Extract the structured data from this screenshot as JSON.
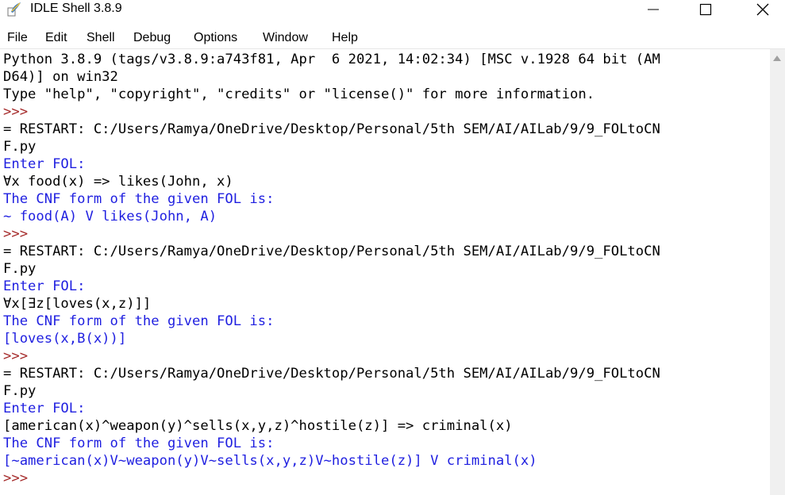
{
  "window": {
    "title": "IDLE Shell 3.8.9",
    "icon": "python-feather-icon"
  },
  "menubar": [
    "File",
    "Edit",
    "Shell",
    "Debug",
    "Options",
    "Window",
    "Help"
  ],
  "colors": {
    "stdout": "#000000",
    "stdin_prompt": "#1f1fe0",
    "shell_prompt": "#a52a2a"
  },
  "shell_lines": [
    {
      "text": "Python 3.8.9 (tags/v3.8.9:a743f81, Apr  6 2021, 14:02:34) [MSC v.1928 64 bit (AM",
      "kind": "out"
    },
    {
      "text": "D64)] on win32",
      "kind": "out"
    },
    {
      "text": "Type \"help\", \"copyright\", \"credits\" or \"license()\" for more information.",
      "kind": "out"
    },
    {
      "text": ">>> ",
      "kind": "prompt"
    },
    {
      "text": "= RESTART: C:/Users/Ramya/OneDrive/Desktop/Personal/5th SEM/AI/AILab/9/9_FOLtoCN",
      "kind": "out"
    },
    {
      "text": "F.py",
      "kind": "out"
    },
    {
      "text": "Enter FOL:",
      "kind": "blue"
    },
    {
      "text": "∀x food(x) => likes(John, x)",
      "kind": "out"
    },
    {
      "text": "The CNF form of the given FOL is:",
      "kind": "blue"
    },
    {
      "text": "~ food(A) V likes(John, A)",
      "kind": "blue"
    },
    {
      "text": ">>> ",
      "kind": "prompt"
    },
    {
      "text": "= RESTART: C:/Users/Ramya/OneDrive/Desktop/Personal/5th SEM/AI/AILab/9/9_FOLtoCN",
      "kind": "out"
    },
    {
      "text": "F.py",
      "kind": "out"
    },
    {
      "text": "Enter FOL:",
      "kind": "blue"
    },
    {
      "text": "∀x[∃z[loves(x,z)]]",
      "kind": "out"
    },
    {
      "text": "The CNF form of the given FOL is:",
      "kind": "blue"
    },
    {
      "text": "[loves(x,B(x))]",
      "kind": "blue"
    },
    {
      "text": ">>> ",
      "kind": "prompt"
    },
    {
      "text": "= RESTART: C:/Users/Ramya/OneDrive/Desktop/Personal/5th SEM/AI/AILab/9/9_FOLtoCN",
      "kind": "out"
    },
    {
      "text": "F.py",
      "kind": "out"
    },
    {
      "text": "Enter FOL:",
      "kind": "blue"
    },
    {
      "text": "[american(x)^weapon(y)^sells(x,y,z)^hostile(z)] => criminal(x)",
      "kind": "out"
    },
    {
      "text": "The CNF form of the given FOL is:",
      "kind": "blue"
    },
    {
      "text": "[~american(x)V~weapon(y)V~sells(x,y,z)V~hostile(z)] V criminal(x)",
      "kind": "blue"
    },
    {
      "text": ">>> ",
      "kind": "prompt"
    }
  ]
}
